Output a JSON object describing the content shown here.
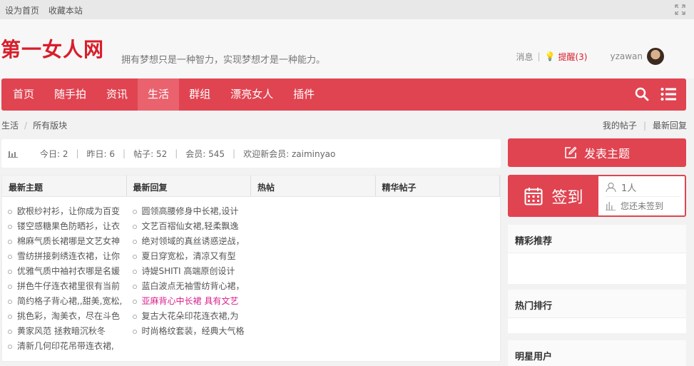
{
  "topbar": {
    "set_home": "设为首页",
    "bookmark": "收藏本站"
  },
  "header": {
    "logo": "第一女人网",
    "slogan": "拥有梦想只是一种智力，实现梦想才是一种能力。",
    "messages": "消息",
    "reminder": "提醒(3)",
    "username": "yzawan"
  },
  "nav": {
    "items": [
      "首页",
      "随手拍",
      "资讯",
      "生活",
      "群组",
      "漂亮女人",
      "插件"
    ],
    "active": "生活"
  },
  "breadcrumb": {
    "level1": "生活",
    "level2": "所有版块"
  },
  "quick_links": {
    "my_posts": "我的帖子",
    "latest_replies": "最新回复"
  },
  "stats": {
    "today": "今日: 2",
    "yesterday": "昨日: 6",
    "posts": "帖子: 52",
    "members": "会员: 545",
    "welcome": "欢迎新会员: zaiminyao"
  },
  "board": {
    "headers": [
      "最新主题",
      "最新回复",
      "热帖",
      "精华帖子"
    ],
    "latest_topics": [
      "欧根纱衬衫，让你成为百变",
      "镂空感糖果色防晒衫，让衣",
      "棉麻气质长裙哪是文艺女神",
      "雪纺拼接刺绣连衣裙，让你",
      "优雅气质中袖衬衣哪是名媛",
      "拼色牛仔连衣裙里很有当前",
      "简约格子背心裙,,甜美,宽松,",
      "挑色彩，淘美衣，尽在斗色",
      "黄家风范 拯救暗沉秋冬",
      "清新几何印花吊带连衣裙,"
    ],
    "latest_replies": [
      "圆领高腰修身中长裙,设计",
      "文艺百褶仙女裙,轻柔飘逸",
      "绝对领域的真丝诱惑逆战，",
      "夏日穿宽松，清凉又有型",
      "诗媞SHITI 高端原创设计",
      "蓝白波点无袖雪纺背心裙，",
      "亚麻背心中长裙 具有文艺",
      "复古大花朵印花连衣裙,为",
      "时尚格纹套装，经典大气格"
    ]
  },
  "sidebar": {
    "post_button": "发表主题",
    "signin_label": "签到",
    "signin_count": "1人",
    "signin_status": "您还未签到",
    "featured_title": "精彩推荐",
    "ranking_title": "热门排行",
    "stars_title": "明星用户"
  },
  "colors": {
    "brand_red": "#e04451",
    "logo_red": "#d81e2a",
    "active_nav": "#e9626d"
  }
}
